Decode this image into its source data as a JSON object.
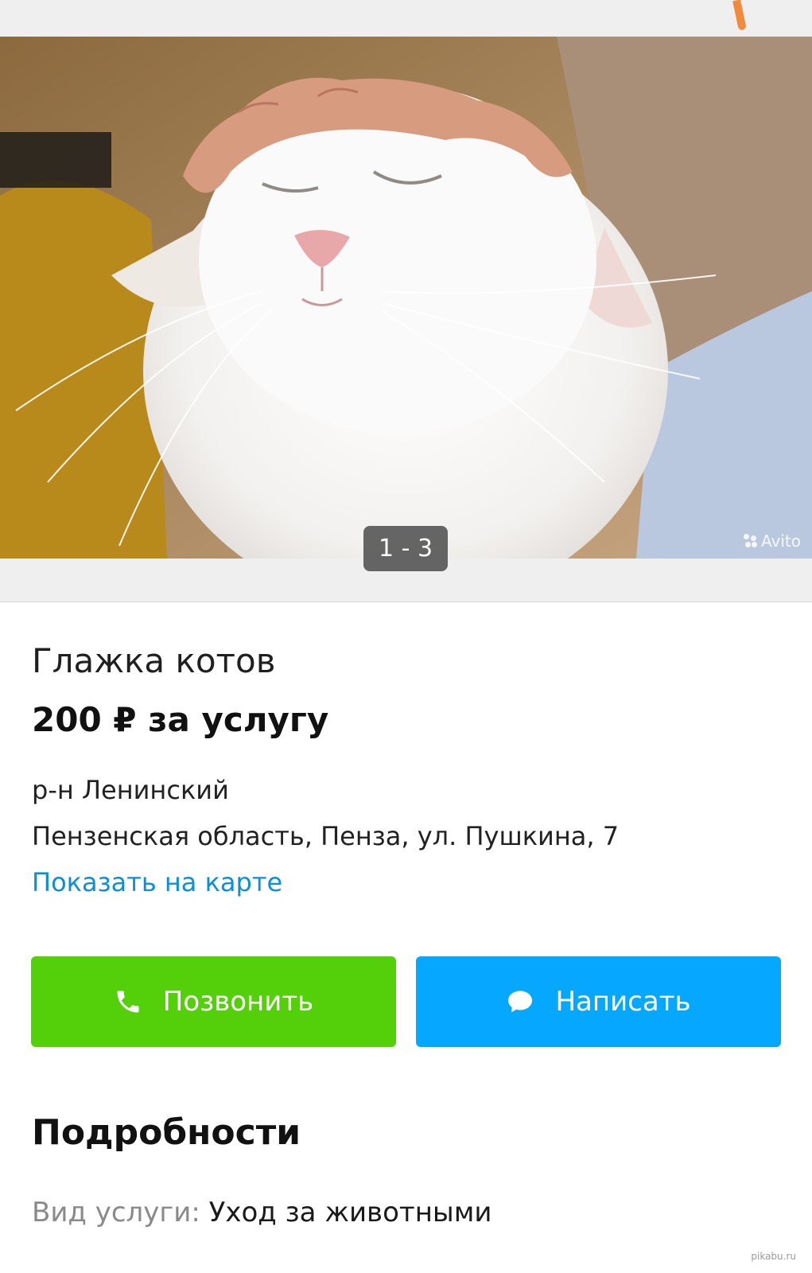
{
  "gallery": {
    "counter": "1 - 3",
    "watermark": "Avito",
    "image_alt": "white cat being petted"
  },
  "listing": {
    "title": "Глажка котов",
    "price": "200 ₽ за услугу",
    "district": "р-н Ленинский",
    "address": "Пензенская область, Пенза, ул. Пушкина, 7",
    "map_link": "Показать на карте"
  },
  "actions": {
    "call_label": "Позвонить",
    "write_label": "Написать"
  },
  "details": {
    "heading": "Подробности",
    "service_label": "Вид услуги:",
    "service_value": "Уход за животными"
  },
  "footer": {
    "source": "pikabu.ru"
  },
  "colors": {
    "call_button": "#53d00a",
    "write_button": "#06a8ff",
    "link": "#0a8fd8"
  }
}
